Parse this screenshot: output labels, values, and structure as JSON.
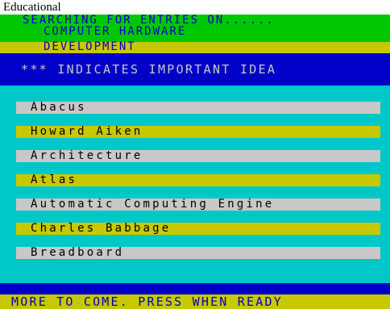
{
  "category_label": "Educational",
  "header": {
    "line1": "SEARCHING FOR ENTRIES ON......",
    "line2": "COMPUTER HARDWARE",
    "line3": "DEVELOPMENT"
  },
  "note": "*** INDICATES IMPORTANT IDEA",
  "entries": [
    "Abacus",
    "Howard Aiken",
    "Architecture",
    "Atlas",
    "Automatic Computing Engine",
    "Charles Babbage",
    "Breadboard"
  ],
  "footer": "MORE TO COME. PRESS WHEN READY",
  "colors": {
    "cyan": "#00c8c8",
    "green": "#00c800",
    "yellow": "#c8c800",
    "blue": "#0000c8",
    "grey": "#c8c8c8"
  }
}
